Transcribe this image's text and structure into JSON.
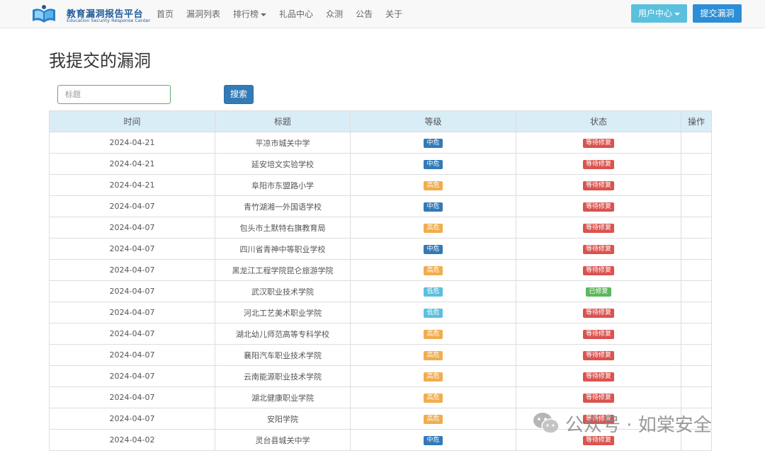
{
  "brand": {
    "title": "教育漏洞报告平台",
    "subtitle": "Education Security Response Center"
  },
  "nav": [
    {
      "label": "首页"
    },
    {
      "label": "漏洞列表"
    },
    {
      "label": "排行榜",
      "dropdown": true
    },
    {
      "label": "礼品中心"
    },
    {
      "label": "众测"
    },
    {
      "label": "公告"
    },
    {
      "label": "关于"
    }
  ],
  "user_center": "用户中心",
  "submit_vuln": "提交漏洞",
  "page_title": "我提交的漏洞",
  "search": {
    "placeholder": "标题",
    "button": "搜索"
  },
  "table": {
    "headers": [
      "时间",
      "标题",
      "等级",
      "状态",
      "操作"
    ],
    "rows": [
      {
        "date": "2024-04-21",
        "title": "平凉市城关中学",
        "level": "中危",
        "status": "等待修复"
      },
      {
        "date": "2024-04-21",
        "title": "延安培文实验学校",
        "level": "中危",
        "status": "等待修复"
      },
      {
        "date": "2024-04-21",
        "title": "阜阳市东盟路小学",
        "level": "高危",
        "status": "等待修复"
      },
      {
        "date": "2024-04-07",
        "title": "青竹湖湘一外国语学校",
        "level": "中危",
        "status": "等待修复"
      },
      {
        "date": "2024-04-07",
        "title": "包头市土默特右旗教育局",
        "level": "高危",
        "status": "等待修复"
      },
      {
        "date": "2024-04-07",
        "title": "四川省青神中等职业学校",
        "level": "中危",
        "status": "等待修复"
      },
      {
        "date": "2024-04-07",
        "title": "黑龙江工程学院昆仑旅游学院",
        "level": "高危",
        "status": "等待修复"
      },
      {
        "date": "2024-04-07",
        "title": "武汉职业技术学院",
        "level": "低危",
        "status": "已修复"
      },
      {
        "date": "2024-04-07",
        "title": "河北工艺美术职业学院",
        "level": "低危",
        "status": "等待修复"
      },
      {
        "date": "2024-04-07",
        "title": "湖北幼儿师范高等专科学校",
        "level": "高危",
        "status": "等待修复"
      },
      {
        "date": "2024-04-07",
        "title": "襄阳汽车职业技术学院",
        "level": "高危",
        "status": "等待修复"
      },
      {
        "date": "2024-04-07",
        "title": "云南能源职业技术学院",
        "level": "高危",
        "status": "等待修复"
      },
      {
        "date": "2024-04-07",
        "title": "湖北健康职业学院",
        "level": "高危",
        "status": "等待修复"
      },
      {
        "date": "2024-04-07",
        "title": "安阳学院",
        "level": "高危",
        "status": "等待修复"
      },
      {
        "date": "2024-04-02",
        "title": "灵台县城关中学",
        "level": "中危",
        "status": "等待修复"
      }
    ]
  },
  "watermark": "公众号 · 如棠安全",
  "colors": {
    "level_mid": "#337ab7",
    "level_high": "#f0ad4e",
    "level_low": "#5bc0de",
    "status_wait": "#d9534f",
    "status_fixed": "#5cb85c",
    "header_bg": "#d9edf7"
  }
}
